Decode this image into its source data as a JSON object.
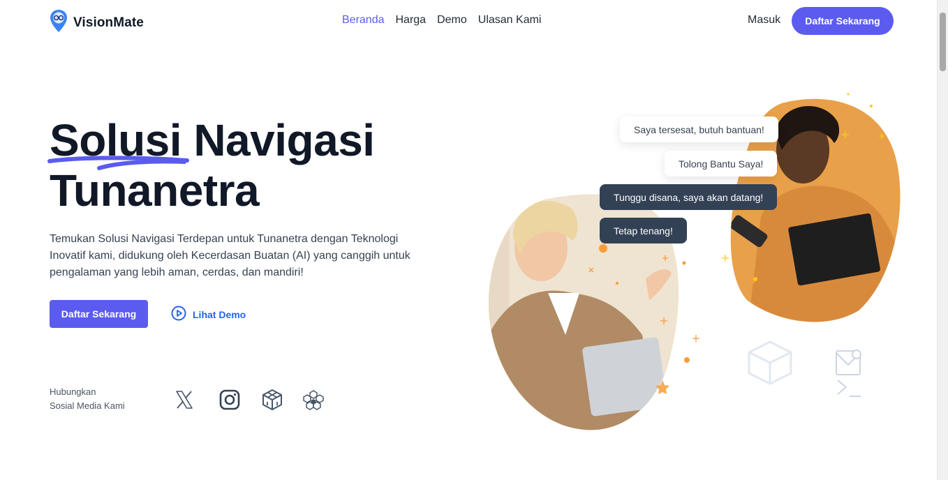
{
  "brand": {
    "name": "VisionMate",
    "logo_icon": "map-pin-eye-icon"
  },
  "nav": {
    "items": [
      {
        "label": "Beranda",
        "active": true
      },
      {
        "label": "Harga",
        "active": false
      },
      {
        "label": "Demo",
        "active": false
      },
      {
        "label": "Ulasan Kami",
        "active": false
      }
    ],
    "login": "Masuk",
    "signup": "Daftar Sekarang"
  },
  "hero": {
    "title_line1_part1": "Solusi",
    "title_line1_part2": "Navigasi",
    "title_line2": "Tunanetra",
    "description": "Temukan Solusi Navigasi Terdepan untuk Tunanetra dengan Teknologi Inovatif kami, didukung oleh Kecerdasan Buatan (AI) yang canggih untuk pengalaman yang lebih aman, cerdas, dan mandiri!",
    "cta": "Daftar Sekarang",
    "demo": "Lihat Demo"
  },
  "social": {
    "label_line1": "Hubungkan",
    "label_line2": "Sosial Media Kami",
    "icons": [
      "x-icon",
      "instagram-icon",
      "codesandbox-icon",
      "hexagon-cluster-icon"
    ]
  },
  "chat": [
    {
      "text": "Saya tersesat, butuh bantuan!",
      "style": "light"
    },
    {
      "text": "Tolong Bantu Saya!",
      "style": "light"
    },
    {
      "text": "Tunggu disana, saya akan datang!",
      "style": "dark"
    },
    {
      "text": "Tetap tenang!",
      "style": "dark"
    }
  ],
  "colors": {
    "accent": "#5b5bf0",
    "link": "#2563eb",
    "dark_bubble": "#334155",
    "yellow_blob": "#facc15",
    "orange_blob": "#f59e3a"
  }
}
